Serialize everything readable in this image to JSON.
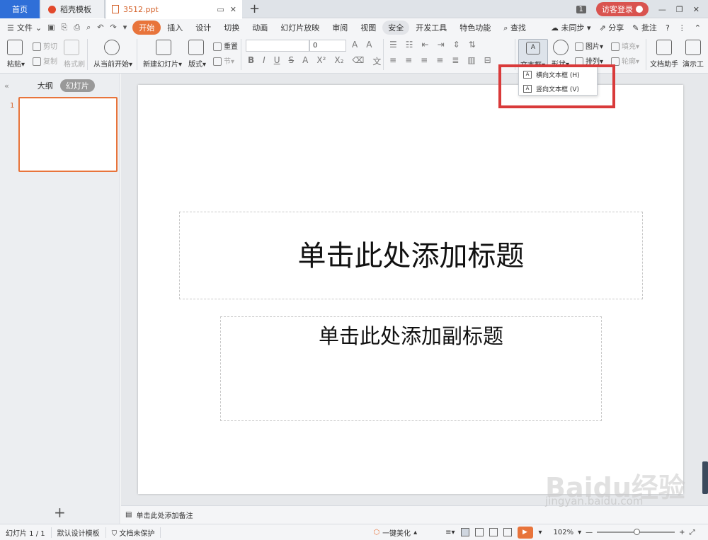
{
  "tabs": {
    "home": "首页",
    "docer": "稻壳模板",
    "document": "3512.ppt",
    "counter": "1",
    "login": "访客登录"
  },
  "menu": {
    "file": "文件",
    "items": [
      "开始",
      "插入",
      "设计",
      "切换",
      "动画",
      "幻灯片放映",
      "审阅",
      "视图",
      "安全",
      "开发工具",
      "特色功能"
    ],
    "active": "开始",
    "search": "查找",
    "sync": "未同步",
    "share": "分享",
    "annotate": "批注"
  },
  "ribbon": {
    "paste": "粘贴",
    "cut": "剪切",
    "copy": "复制",
    "format_painter": "格式刷",
    "play_from_current": "从当前开始",
    "new_slide": "新建幻灯片",
    "layout": "版式",
    "reset": "重置",
    "section": "节",
    "font_size": "0",
    "textbox": "文本框",
    "shape": "形状",
    "picture": "图片",
    "fill": "填充",
    "arrange": "排列",
    "outline": "轮廓",
    "doc_assistant": "文档助手",
    "presentation": "演示工"
  },
  "dropdown": {
    "horizontal": "横向文本框 (H)",
    "vertical": "竖向文本框 (V)"
  },
  "left_pane": {
    "outline_tab": "大纲",
    "slides_tab": "幻灯片",
    "slide_number": "1"
  },
  "slide": {
    "title_placeholder": "单击此处添加标题",
    "subtitle_placeholder": "单击此处添加副标题"
  },
  "notes": "单击此处添加备注",
  "status": {
    "slide_counter": "幻灯片 1 / 1",
    "template": "默认设计模板",
    "protection": "文档未保护",
    "beautify": "一键美化",
    "zoom": "102%"
  },
  "watermark": {
    "logo": "Baidu经验",
    "url": "jingyan.baidu.com"
  },
  "colors": {
    "accent": "#e8743b",
    "home_tab": "#2f6fd8",
    "highlight": "#d93a3a"
  }
}
